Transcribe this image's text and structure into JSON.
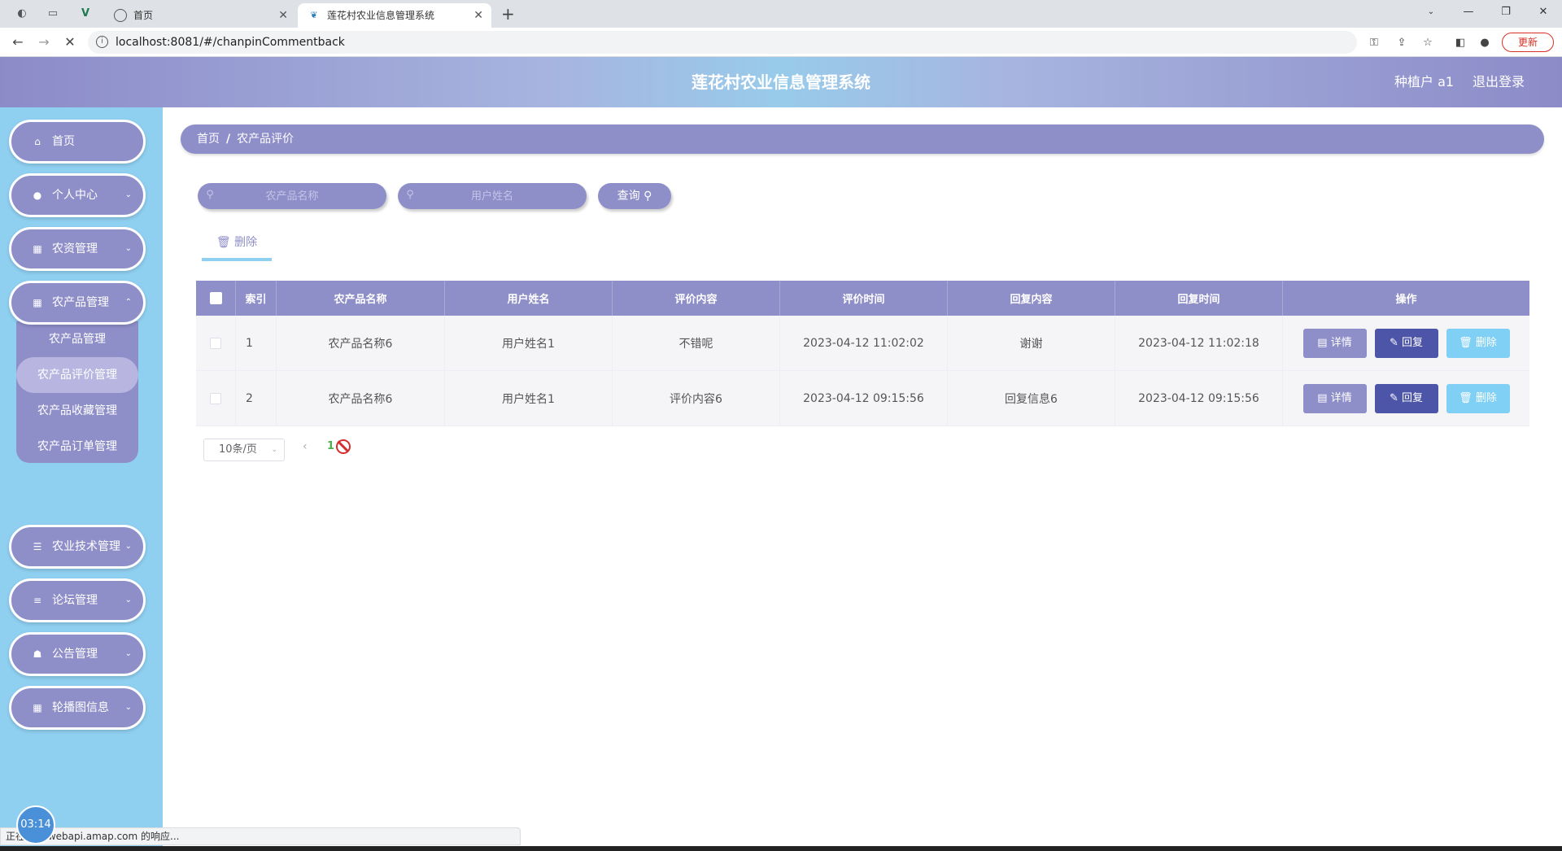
{
  "browser": {
    "tabs": [
      {
        "label": "首页"
      },
      {
        "label": "莲花村农业信息管理系统"
      }
    ],
    "url": "localhost:8081/#/chanpinCommentback",
    "update_label": "更新",
    "status_text": "正在等待 webapi.amap.com 的响应..."
  },
  "header": {
    "title": "莲花村农业信息管理系统",
    "user": "种植户 a1",
    "logout": "退出登录"
  },
  "sidebar": {
    "items": [
      {
        "label": "首页",
        "icon": "home-icon"
      },
      {
        "label": "个人中心",
        "icon": "user-icon"
      },
      {
        "label": "农资管理",
        "icon": "grid-icon"
      },
      {
        "label": "农产品管理",
        "icon": "grid-icon"
      },
      {
        "label": "农业技术管理",
        "icon": "sliders-icon"
      },
      {
        "label": "论坛管理",
        "icon": "list-icon"
      },
      {
        "label": "公告管理",
        "icon": "thumb-icon"
      },
      {
        "label": "轮播图信息",
        "icon": "apps-icon"
      }
    ],
    "submenu": [
      {
        "label": "农产品管理"
      },
      {
        "label": "农产品评价管理"
      },
      {
        "label": "农产品收藏管理"
      },
      {
        "label": "农产品订单管理"
      }
    ],
    "timer": "03:14"
  },
  "breadcrumb": {
    "home": "首页",
    "separator": "/",
    "current": "农产品评价"
  },
  "search": {
    "product_placeholder": "农产品名称",
    "user_placeholder": "用户姓名",
    "query_label": "查询"
  },
  "actions": {
    "batch_delete": "删除"
  },
  "table": {
    "headers": [
      "索引",
      "农产品名称",
      "用户姓名",
      "评价内容",
      "评价时间",
      "回复内容",
      "回复时间",
      "操作"
    ],
    "rows": [
      {
        "index": "1",
        "product": "农产品名称6",
        "user": "用户姓名1",
        "content": "不错呢",
        "time": "2023-04-12 11:02:02",
        "reply": "谢谢",
        "reply_time": "2023-04-12 11:02:18"
      },
      {
        "index": "2",
        "product": "农产品名称6",
        "user": "用户姓名1",
        "content": "评价内容6",
        "time": "2023-04-12 09:15:56",
        "reply": "回复信息6",
        "reply_time": "2023-04-12 09:15:56"
      }
    ],
    "ops": {
      "detail": "详情",
      "reply": "回复",
      "delete": "删除"
    }
  },
  "pager": {
    "size": "10条/页",
    "current": "1"
  },
  "colors": {
    "primary": "#8e8ec9",
    "sidebar_bg": "#8fcff0",
    "reply_btn": "#4d55a8",
    "delete_btn": "#7fd0f4"
  }
}
